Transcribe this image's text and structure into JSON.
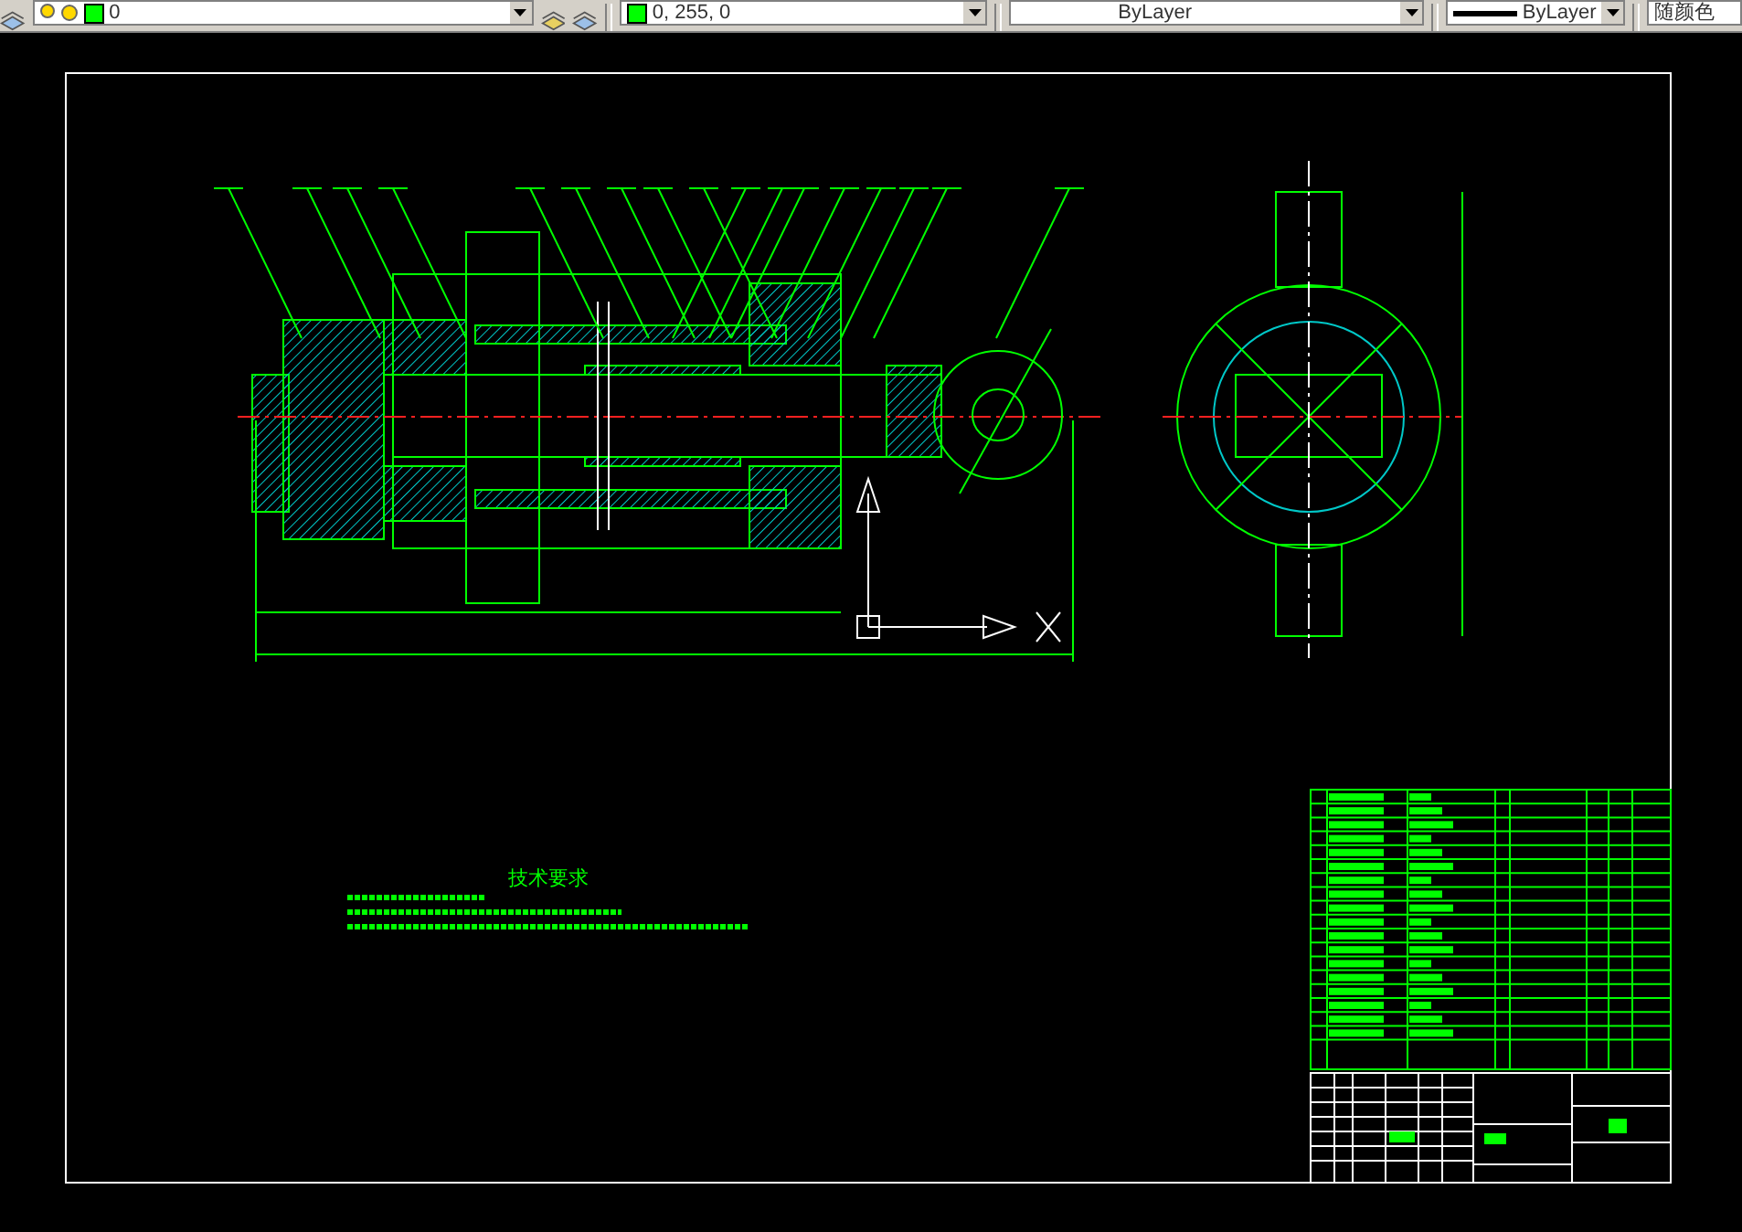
{
  "toolbar": {
    "layer": "0",
    "color_reading": "0, 255, 0",
    "linetype": "ByLayer",
    "lineweight": "ByLayer",
    "plot_style": "随颜色"
  },
  "drawing": {
    "notes_heading": "技术要求"
  }
}
